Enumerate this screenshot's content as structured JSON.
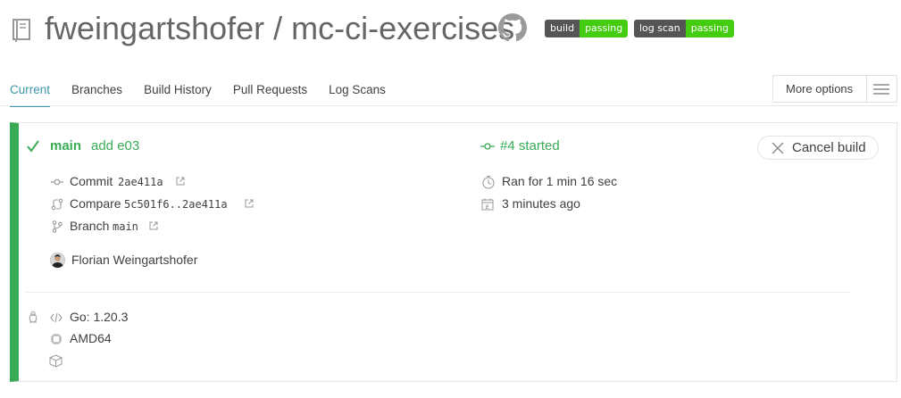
{
  "repo": {
    "title": "fweingartshofer / mc-ci-exercises"
  },
  "badges": [
    {
      "label": "build",
      "status": "passing"
    },
    {
      "label": "log scan",
      "status": "passing"
    }
  ],
  "tabs": [
    {
      "label": "Current",
      "active": true
    },
    {
      "label": "Branches"
    },
    {
      "label": "Build History"
    },
    {
      "label": "Pull Requests"
    },
    {
      "label": "Log Scans"
    }
  ],
  "more_options": {
    "label": "More options"
  },
  "build": {
    "branch": "main",
    "message": "add e03",
    "number_text": "#4 started",
    "cancel_label": "Cancel build",
    "commit_label": "Commit",
    "commit_sha": "2ae411a",
    "compare_label": "Compare",
    "compare_range": "5c501f6..2ae411a",
    "branch_label": "Branch",
    "branch_value": "main",
    "duration": "Ran for 1 min 16 sec",
    "finished": "3 minutes ago",
    "author": "Florian Weingartshofer",
    "language": "Go: 1.20.3",
    "arch": "AMD64"
  },
  "colors": {
    "passed": "#39aa56",
    "accent": "#3d97a8",
    "badge_dark": "#555555",
    "badge_green": "#44cc11"
  },
  "icons": [
    "repo-icon",
    "github-icon",
    "check-icon",
    "commit-icon",
    "compare-icon",
    "branch-icon",
    "external-link-icon",
    "stopwatch-icon",
    "calendar-icon",
    "linux-icon",
    "code-icon",
    "cpu-icon",
    "box-icon",
    "close-icon",
    "hamburger-icon"
  ]
}
